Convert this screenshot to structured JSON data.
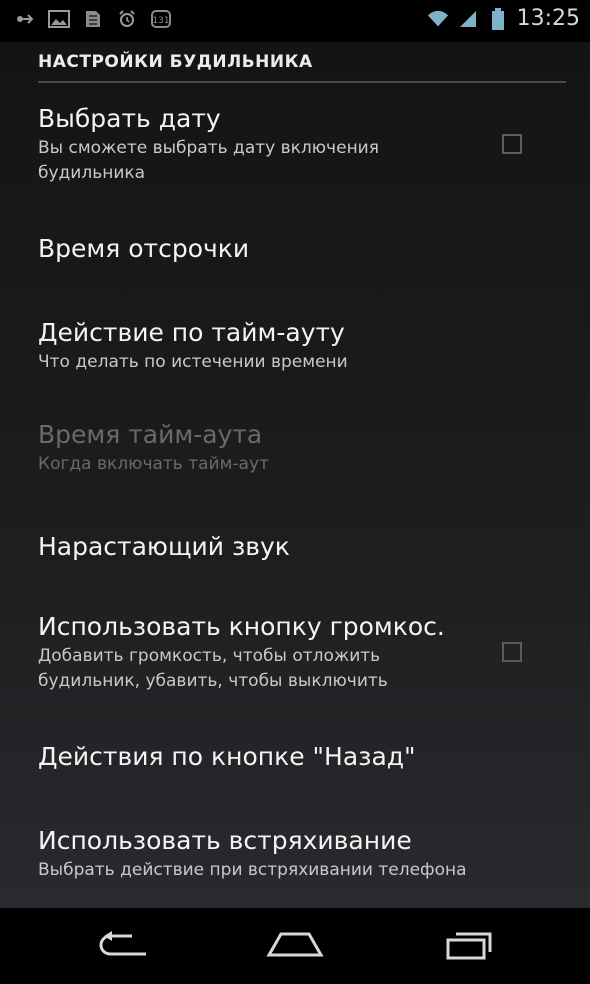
{
  "status_bar": {
    "time": "13:25",
    "left_icons": [
      "usb-icon",
      "image-icon",
      "storage-icon",
      "alarm-clock-icon",
      "sim-icon"
    ],
    "right_icons": [
      "wifi-icon",
      "signal-icon",
      "battery-icon"
    ]
  },
  "header": {
    "title": "НАСТРОЙКИ БУДИЛЬНИКА"
  },
  "prefs": [
    {
      "title": "Выбрать дату",
      "summary_lines": [
        "Вы сможете выбрать дату включения",
        "будильника"
      ],
      "checked": false,
      "enabled": true
    },
    {
      "title": "Время отсрочки",
      "summary_lines": [],
      "enabled": true
    },
    {
      "title": "Действие по тайм-ауту",
      "summary_lines": [
        "Что делать по истечении времени"
      ],
      "enabled": true
    },
    {
      "title": "Время тайм-аута",
      "summary_lines": [
        "Когда включать тайм-аут"
      ],
      "enabled": false
    },
    {
      "title": "Нарастающий звук",
      "summary_lines": [],
      "enabled": true
    },
    {
      "title": "Использовать кнопку громкос.",
      "summary_lines": [
        "Добавить громкость, чтобы отложить",
        "будильник, убавить, чтобы выключить"
      ],
      "checked": false,
      "enabled": true
    },
    {
      "title": "Действия по кнопке \"Назад\"",
      "summary_lines": [],
      "enabled": true
    },
    {
      "title": "Использовать встряхивание",
      "summary_lines": [
        "Выбрать действие при встряхивании телефона"
      ],
      "enabled": true
    }
  ],
  "nav": [
    "back-icon",
    "home-icon",
    "recent-apps-icon"
  ]
}
